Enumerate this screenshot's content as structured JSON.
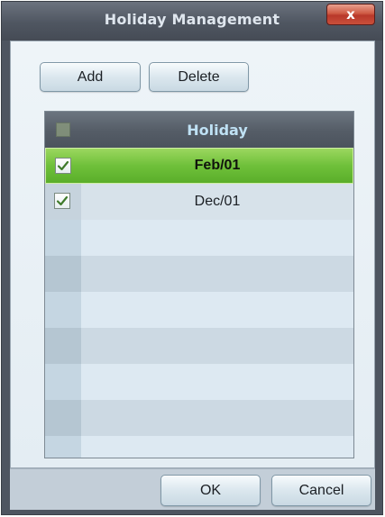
{
  "window": {
    "title": "Holiday Management",
    "close_glyph": "x"
  },
  "toolbar": {
    "add_label": "Add",
    "delete_label": "Delete"
  },
  "table": {
    "header_label": "Holiday",
    "rows": [
      {
        "date": "Feb/01",
        "checked": true,
        "selected": true
      },
      {
        "date": "Dec/01",
        "checked": true,
        "selected": false
      }
    ]
  },
  "footer": {
    "ok_label": "OK",
    "cancel_label": "Cancel"
  },
  "colors": {
    "selected_row": "#6fc03a",
    "header_text": "#bfe1f4",
    "close_button": "#c9503b"
  },
  "icons": {
    "close": "close-icon",
    "check": "check-icon"
  }
}
